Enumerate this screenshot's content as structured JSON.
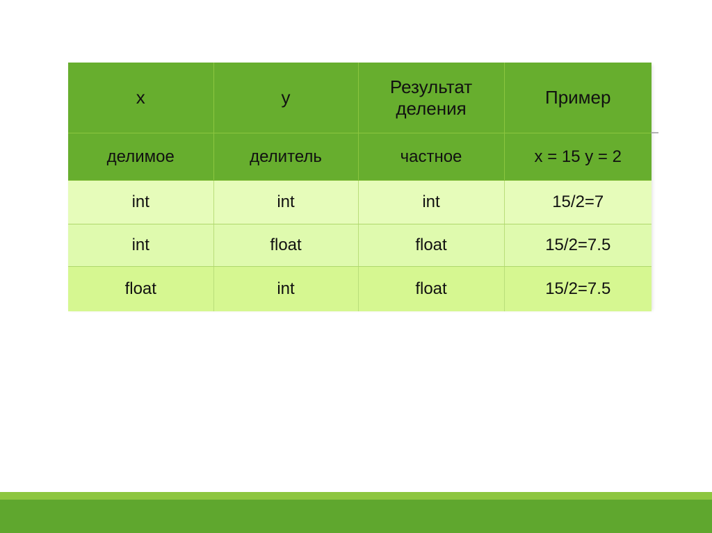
{
  "slide": {
    "background_color": "#FFFFFF"
  },
  "table": {
    "name": "division-result-types-table",
    "header_bg": "#67AE2E",
    "row_bg_1": "#E6FCBA",
    "row_bg_2": "#DFFAAE",
    "row_bg_3": "#D6F791",
    "grid_color": "#8CC63F",
    "header_rows": [
      {
        "cells": [
          {
            "lines": [
              "x"
            ]
          },
          {
            "lines": [
              "y"
            ]
          },
          {
            "lines": [
              "Результат",
              "деления"
            ]
          },
          {
            "lines": [
              "Пример"
            ]
          }
        ]
      },
      {
        "cells": [
          {
            "lines": [
              "делимое"
            ]
          },
          {
            "lines": [
              "делитель"
            ]
          },
          {
            "lines": [
              "частное"
            ]
          },
          {
            "lines": [
              "x = 15 y = 2"
            ]
          }
        ]
      }
    ],
    "body_rows": [
      {
        "x": "int",
        "y": "int",
        "result": "int",
        "example": "15/2=7"
      },
      {
        "x": "int",
        "y": "float",
        "result": "float",
        "example": "15/2=7.5"
      },
      {
        "x": "float",
        "y": "int",
        "result": "float",
        "example": "15/2=7.5"
      }
    ]
  },
  "footer": {
    "stripe_light_color": "#8DC63F",
    "stripe_dark_color": "#5FA72E"
  }
}
